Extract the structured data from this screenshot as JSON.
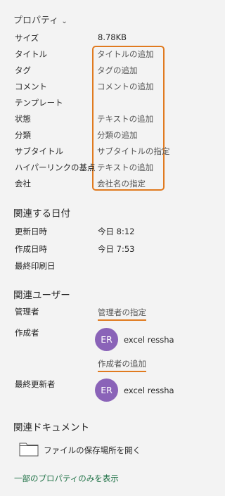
{
  "header": {
    "title": "プロパティ",
    "chevron": "chevron-down-icon"
  },
  "properties": [
    {
      "label": "サイズ",
      "value": "8.78KB"
    },
    {
      "label": "タイトル",
      "value": "タイトルの追加"
    },
    {
      "label": "タグ",
      "value": "タグの追加"
    },
    {
      "label": "コメント",
      "value": "コメントの追加"
    },
    {
      "label": "テンプレート",
      "value": ""
    },
    {
      "label": "状態",
      "value": "テキストの追加"
    },
    {
      "label": "分類",
      "value": "分類の追加"
    },
    {
      "label": "サブタイトル",
      "value": "サブタイトルの指定"
    },
    {
      "label": "ハイパーリンクの基点",
      "value": "テキストの追加"
    },
    {
      "label": "会社",
      "value": "会社名の指定"
    }
  ],
  "dates": {
    "title": "関連する日付",
    "rows": [
      {
        "label": "更新日時",
        "value": "今日 8:12"
      },
      {
        "label": "作成日時",
        "value": "今日 7:53"
      },
      {
        "label": "最終印刷日",
        "value": ""
      }
    ]
  },
  "users": {
    "title": "関連ユーザー",
    "manager_label": "管理者",
    "manager_placeholder": "管理者の指定",
    "author_label": "作成者",
    "author_initials": "ER",
    "author_name": "excel ressha",
    "add_author": "作成者の追加",
    "last_modified_label": "最終更新者",
    "last_modified_initials": "ER",
    "last_modified_name": "excel ressha"
  },
  "documents": {
    "title": "関連ドキュメント",
    "open_location": "ファイルの保存場所を開く"
  },
  "footer": {
    "show_some": "一部のプロパティのみを表示"
  }
}
